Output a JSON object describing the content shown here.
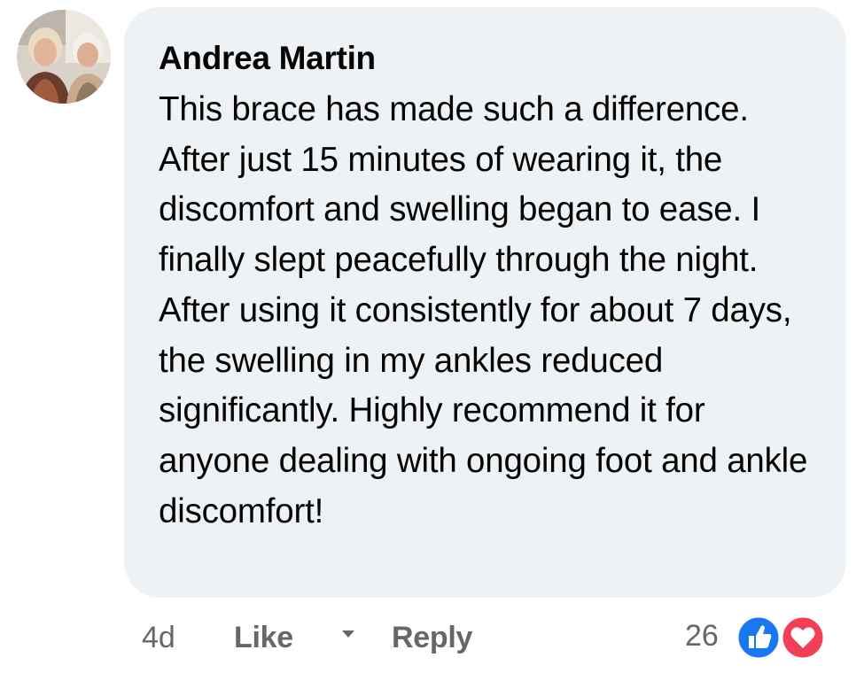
{
  "comment": {
    "author": "Andrea Martin",
    "text": "This brace has made such a difference. After just 15 minutes of wearing it, the discomfort and swelling began to ease. I finally slept peacefully through the night. After using it consistently for about 7 days, the swelling in my ankles reduced significantly. Highly recommend it for anyone dealing with ongoing foot and ankle discomfort!"
  },
  "meta": {
    "time": "4d",
    "like_label": "Like",
    "reply_label": "Reply",
    "reaction_count": "26",
    "reaction_icons": [
      "like-icon",
      "love-icon"
    ]
  },
  "colors": {
    "bubble_bg": "#eff2f5",
    "text": "#050505",
    "secondary": "#65676b",
    "like_blue": "#1877f2",
    "love_red": "#f33e58"
  }
}
